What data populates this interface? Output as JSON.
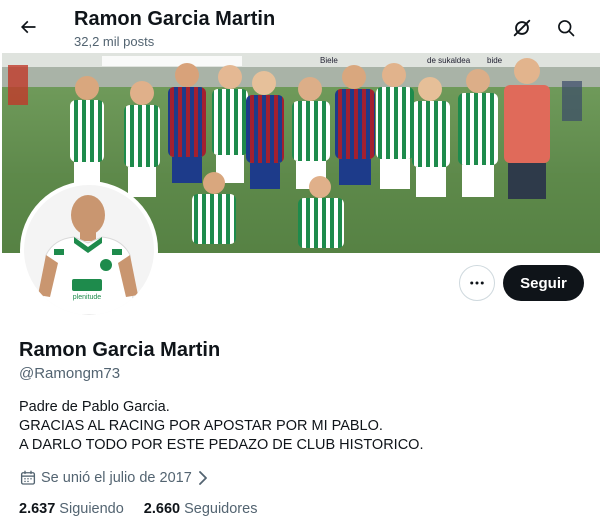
{
  "header": {
    "title": "Ramon Garcia Martin",
    "posts": "32,2 mil posts",
    "back_icon": "arrow-left-icon",
    "grok_icon": "grok-slash-icon",
    "search_icon": "search-icon"
  },
  "profile": {
    "name": "Ramon Garcia Martin",
    "handle": "@Ramongm73",
    "bio": [
      "Padre de Pablo Garcia.",
      "GRACIAS AL RACING POR APOSTAR POR MI PABLO.",
      "A DARLO TODO POR ESTE PEDAZO DE CLUB HISTORICO."
    ],
    "joined": "Se unió el julio de 2017",
    "following_count": "2.637",
    "following_label": "Siguiendo",
    "followers_count": "2.660",
    "followers_label": "Seguidores"
  },
  "actions": {
    "follow_label": "Seguir",
    "more_icon": "more-dots-icon"
  },
  "banner": {
    "signage": [
      "Biele",
      "de sukaldea",
      "bide"
    ]
  },
  "avatar": {
    "shirt_text": "plenitude"
  },
  "colors": {
    "text": "#0f1419",
    "secondary": "#536471",
    "button_dark": "#0f1419",
    "border": "#cfd9de",
    "green_stripe": "#1e8b4c"
  }
}
